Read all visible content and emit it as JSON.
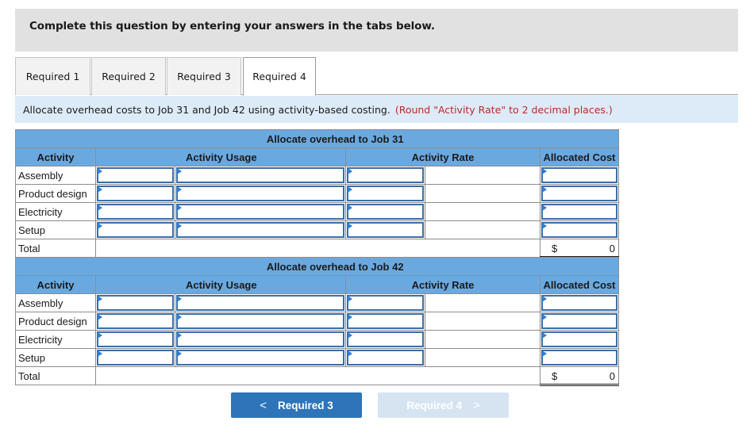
{
  "banner": {
    "text": "Complete this question by entering your answers in the tabs below."
  },
  "tabs": [
    {
      "label": "Required 1",
      "active": false
    },
    {
      "label": "Required 2",
      "active": false
    },
    {
      "label": "Required 3",
      "active": false
    },
    {
      "label": "Required 4",
      "active": true
    }
  ],
  "instruction": {
    "text": "Allocate overhead costs to Job 31 and Job 42 using activity-based costing.",
    "note": "(Round \"Activity Rate\" to 2 decimal places.)",
    "note_color": "#c0282d"
  },
  "tables": [
    {
      "title": "Allocate overhead to Job 31",
      "headers": {
        "activity": "Activity",
        "usage": "Activity Usage",
        "rate": "Activity Rate",
        "cost": "Allocated Cost"
      },
      "rows": [
        {
          "label": "Assembly",
          "usage_1": "",
          "usage_2": "",
          "rate": "",
          "cost": ""
        },
        {
          "label": "Product design",
          "usage_1": "",
          "usage_2": "",
          "rate": "",
          "cost": ""
        },
        {
          "label": "Electricity",
          "usage_1": "",
          "usage_2": "",
          "rate": "",
          "cost": ""
        },
        {
          "label": "Setup",
          "usage_1": "",
          "usage_2": "",
          "rate": "",
          "cost": ""
        }
      ],
      "total": {
        "label": "Total",
        "currency": "$",
        "amount": "0"
      }
    },
    {
      "title": "Allocate overhead to Job 42",
      "headers": {
        "activity": "Activity",
        "usage": "Activity Usage",
        "rate": "Activity Rate",
        "cost": "Allocated Cost"
      },
      "rows": [
        {
          "label": "Assembly",
          "usage_1": "",
          "usage_2": "",
          "rate": "",
          "cost": ""
        },
        {
          "label": "Product design",
          "usage_1": "",
          "usage_2": "",
          "rate": "",
          "cost": ""
        },
        {
          "label": "Electricity",
          "usage_1": "",
          "usage_2": "",
          "rate": "",
          "cost": ""
        },
        {
          "label": "Setup",
          "usage_1": "",
          "usage_2": "",
          "rate": "",
          "cost": ""
        }
      ],
      "total": {
        "label": "Total",
        "currency": "$",
        "amount": "0"
      }
    }
  ],
  "navigation": {
    "prev_label": "Required 3",
    "next_label": "Required 4",
    "prev_icon": "chevron-left-icon",
    "next_icon": "chevron-right-icon",
    "prev_glyph": "<",
    "next_glyph": ">",
    "next_disabled": true
  },
  "colors": {
    "header_blue": "#6aa9e0",
    "button_blue": "#2e74b8",
    "button_disabled": "#d6e4f2",
    "info_bg": "#dcebf7",
    "banner_bg": "#e1e1e1"
  }
}
